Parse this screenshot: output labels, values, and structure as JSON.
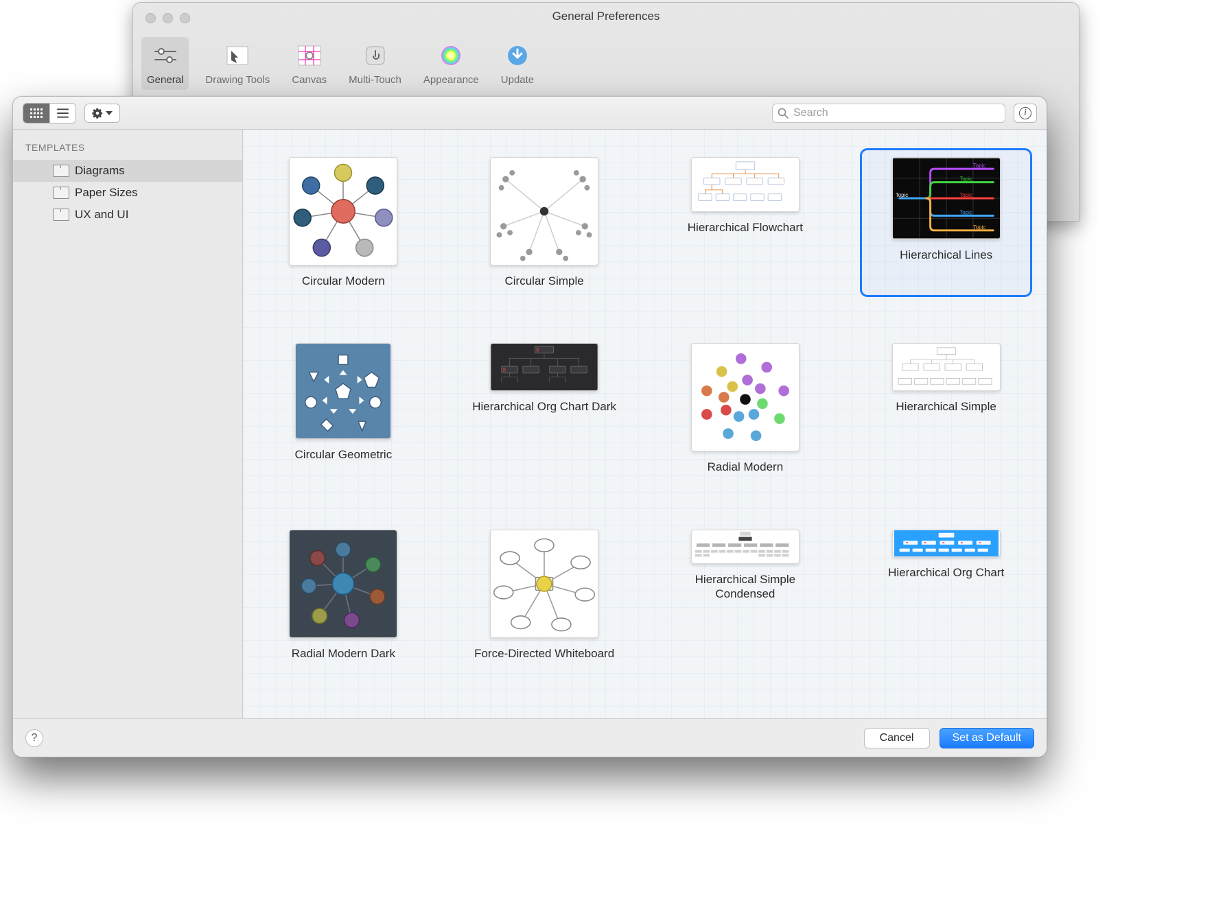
{
  "parentWindow": {
    "title": "General Preferences",
    "tabs": [
      {
        "label": "General",
        "active": true
      },
      {
        "label": "Drawing Tools",
        "active": false
      },
      {
        "label": "Canvas",
        "active": false
      },
      {
        "label": "Multi-Touch",
        "active": false
      },
      {
        "label": "Appearance",
        "active": false
      },
      {
        "label": "Update",
        "active": false
      }
    ]
  },
  "sheet": {
    "search": {
      "placeholder": "Search",
      "value": ""
    },
    "sidebar": {
      "header": "TEMPLATES",
      "items": [
        {
          "label": "Diagrams",
          "selected": true
        },
        {
          "label": "Paper Sizes",
          "selected": false
        },
        {
          "label": "UX and UI",
          "selected": false
        }
      ]
    },
    "templates": [
      {
        "id": "circular-modern",
        "label": "Circular Modern",
        "selected": false,
        "thumb": "circular-modern"
      },
      {
        "id": "circular-simple",
        "label": "Circular Simple",
        "selected": false,
        "thumb": "circular-simple"
      },
      {
        "id": "hierarchical-flowchart",
        "label": "Hierarchical Flowchart",
        "selected": false,
        "thumb": "hier-flow"
      },
      {
        "id": "hierarchical-lines",
        "label": "Hierarchical Lines",
        "selected": true,
        "thumb": "hier-lines"
      },
      {
        "id": "circular-geometric",
        "label": "Circular Geometric",
        "selected": false,
        "thumb": "circ-geo"
      },
      {
        "id": "hierarchical-org-chart-dark",
        "label": "Hierarchical Org Chart Dark",
        "selected": false,
        "thumb": "hier-org-dark"
      },
      {
        "id": "radial-modern",
        "label": "Radial Modern",
        "selected": false,
        "thumb": "radial-modern"
      },
      {
        "id": "hierarchical-simple",
        "label": "Hierarchical Simple",
        "selected": false,
        "thumb": "hier-simple"
      },
      {
        "id": "radial-modern-dark",
        "label": "Radial Modern Dark",
        "selected": false,
        "thumb": "radial-dark"
      },
      {
        "id": "force-directed-whiteboard",
        "label": "Force-Directed Whiteboard",
        "selected": false,
        "thumb": "force-white"
      },
      {
        "id": "hierarchical-simple-condensed",
        "label": "Hierarchical Simple Condensed",
        "selected": false,
        "thumb": "hier-cond"
      },
      {
        "id": "hierarchical-org-chart",
        "label": "Hierarchical Org Chart",
        "selected": false,
        "thumb": "hier-org"
      }
    ],
    "footer": {
      "cancel": "Cancel",
      "setDefault": "Set as Default"
    }
  }
}
